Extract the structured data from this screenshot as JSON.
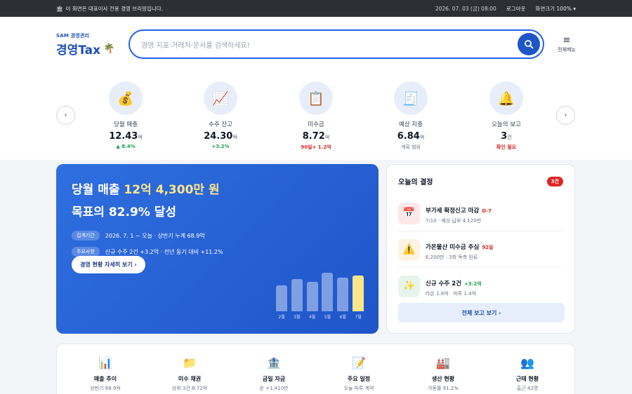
{
  "topbar": {
    "notice_icon": "bank-icon",
    "notice": "이 화면은 대표이사 전용 경영 브리핑입니다.",
    "datetime": "2026. 07. 03 (금) 08:00",
    "logout": "로그아웃",
    "zoom": "화면크기 100% ▾"
  },
  "brand": {
    "small": "SAM 경영관리",
    "big": "경영Tax",
    "emblem": "🌴"
  },
  "search": {
    "placeholder": "경영 지표·거래처·문서를 검색하세요!"
  },
  "menu": {
    "label": "전체메뉴",
    "icon": "≡"
  },
  "kpis": [
    {
      "icon": "💰",
      "name": "당월 매출",
      "value": "12.43",
      "unit": "억",
      "delta": "▲ 8.4%"
    },
    {
      "icon": "📈",
      "name": "수주 잔고",
      "value": "24.30",
      "unit": "억",
      "delta": "+3.2%"
    },
    {
      "icon": "📋",
      "name": "미수금",
      "value": "8.72",
      "unit": "억",
      "delta": "90일+ 1.2억"
    },
    {
      "icon": "🧾",
      "name": "예상 지출",
      "value": "6.84",
      "unit": "억",
      "delta": "계획 범위"
    },
    {
      "icon": "🔔",
      "name": "오늘의 보고",
      "value": "3",
      "unit": "건",
      "delta": "확인 필요"
    }
  ],
  "hero": {
    "line1_pre": "당월 매출 ",
    "line1_hl": "12억 4,300만 원",
    "line2": "목표의 82.9% 달성",
    "rows": [
      {
        "pill": "집계기간",
        "text": "2026. 7. 1 ~ 오늘 · 상반기 누계 68.9억"
      },
      {
        "pill": "주요사항",
        "text": "신규 수주 2건 +3.2억 · 전년 동기 대비 +11.2%"
      }
    ],
    "cta": "경영 현황 자세히 보기 ›",
    "bar_labels": [
      "2월",
      "3월",
      "4월",
      "5월",
      "6월",
      "7월"
    ]
  },
  "chart_data": {
    "type": "bar",
    "categories": [
      "2월",
      "3월",
      "4월",
      "5월",
      "6월",
      "7월"
    ],
    "values": [
      0.6,
      0.74,
      0.67,
      0.88,
      0.78,
      0.82
    ],
    "current_index": 5,
    "title": "",
    "xlabel": "",
    "ylabel": ""
  },
  "decisions": {
    "title": "오늘의 결정",
    "count": "3건",
    "items": [
      {
        "icon": "📅",
        "title": "부가세 확정신고 마감",
        "tag": "D-7",
        "sub": "7/10 · 예상 납부 4,120만"
      },
      {
        "icon": "⚠️",
        "title": "가온물산 미수금 추심",
        "tag": "92일",
        "sub": "6,200만 · 3회 독촉 완료"
      },
      {
        "icon": "✨",
        "title": "신규 수주 2건",
        "tag": "+3.2억",
        "sub": "라온 1.8억 · 마루 1.4억"
      }
    ],
    "full_button": "전체 보고 보기 ›"
  },
  "shortcuts": [
    {
      "icon": "📊",
      "name": "매출 추이",
      "sub": "상반기 68.9억"
    },
    {
      "icon": "📁",
      "name": "미수 채권",
      "sub": "상위 3건 8.72억"
    },
    {
      "icon": "🏦",
      "name": "금일 자금",
      "sub": "순 +1,410만"
    },
    {
      "icon": "📝",
      "name": "주요 일정",
      "sub": "오늘 마루 계약"
    },
    {
      "icon": "🏭",
      "name": "생산 현황",
      "sub": "가동률 91.2%"
    },
    {
      "icon": "👥",
      "name": "근태 현황",
      "sub": "출근 42명"
    }
  ],
  "colors": {
    "brand": "#1e4fb8",
    "hero": "#2563eb",
    "highlight": "#fde68a",
    "alert": "#dc2626",
    "positive": "#16a34a"
  }
}
